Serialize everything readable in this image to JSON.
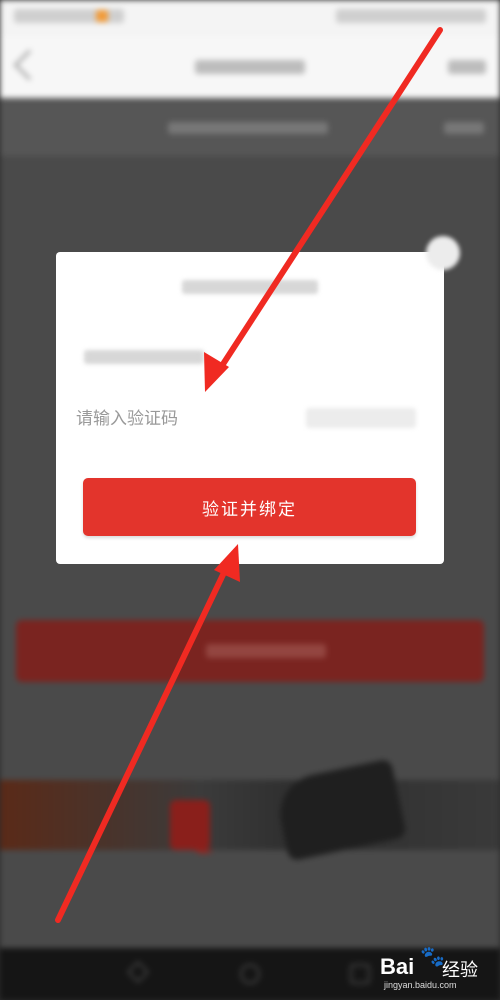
{
  "dialog": {
    "code_placeholder": "请输入验证码",
    "verify_button_label": "验证并绑定"
  },
  "watermark": {
    "brand": "Bai",
    "paw": "🐾",
    "product": "经验",
    "url": "jingyan.baidu.com"
  },
  "colors": {
    "accent": "#e3342c",
    "annotation_arrow": "#f02a22"
  }
}
